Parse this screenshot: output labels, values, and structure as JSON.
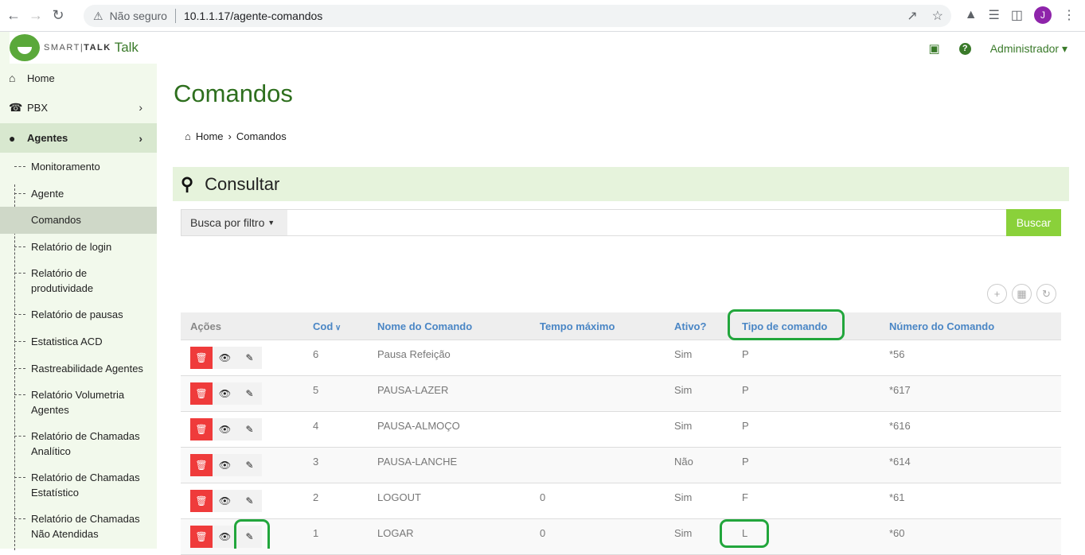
{
  "browser": {
    "security_label": "Não seguro",
    "url": "10.1.1.17/agente-comandos",
    "profile_initial": "J"
  },
  "app": {
    "brand_smart": "SMART",
    "brand_talk_bold": "TALK",
    "brand_talk": "Talk",
    "user_menu": "Administrador"
  },
  "sidebar": {
    "home": "Home",
    "pbx": "PBX",
    "agentes": "Agentes",
    "sub_items": [
      "Monitoramento",
      "Agente",
      "Comandos",
      "Relatório de login",
      "Relatório de produtividade",
      "Relatório de pausas",
      "Estatistica ACD",
      "Rastreabilidade Agentes",
      "Relatório Volumetria Agentes",
      "Relatório de Chamadas Analítico",
      "Relatório de Chamadas Estatístico",
      "Relatório de Chamadas Não Atendidas"
    ]
  },
  "main": {
    "title": "Comandos",
    "breadcrumb_home": "Home",
    "breadcrumb_current": "Comandos",
    "consult_title": "Consultar",
    "filter_label": "Busca por filtro",
    "search_value": "",
    "search_button": "Buscar"
  },
  "table": {
    "headers": {
      "acoes": "Ações",
      "cod": "Cod",
      "nome": "Nome do Comando",
      "tempo": "Tempo máximo",
      "ativo": "Ativo?",
      "tipo": "Tipo de comando",
      "numero": "Número do Comando"
    },
    "rows": [
      {
        "cod": "6",
        "nome": "Pausa Refeição",
        "tempo": "",
        "ativo": "Sim",
        "tipo": "P",
        "numero": "*56"
      },
      {
        "cod": "5",
        "nome": "PAUSA-LAZER",
        "tempo": "",
        "ativo": "Sim",
        "tipo": "P",
        "numero": "*617"
      },
      {
        "cod": "4",
        "nome": "PAUSA-ALMOÇO",
        "tempo": "",
        "ativo": "Sim",
        "tipo": "P",
        "numero": "*616"
      },
      {
        "cod": "3",
        "nome": "PAUSA-LANCHE",
        "tempo": "",
        "ativo": "Não",
        "tipo": "P",
        "numero": "*614"
      },
      {
        "cod": "2",
        "nome": "LOGOUT",
        "tempo": "0",
        "ativo": "Sim",
        "tipo": "F",
        "numero": "*61"
      },
      {
        "cod": "1",
        "nome": "LOGAR",
        "tempo": "0",
        "ativo": "Sim",
        "tipo": "L",
        "numero": "*60"
      }
    ]
  },
  "colors": {
    "brand_green": "#2e6f1e",
    "search_button": "#8ad13a",
    "delete_button": "#ef3b3b",
    "highlight": "#22a63c",
    "header_link": "#4a86c5"
  }
}
